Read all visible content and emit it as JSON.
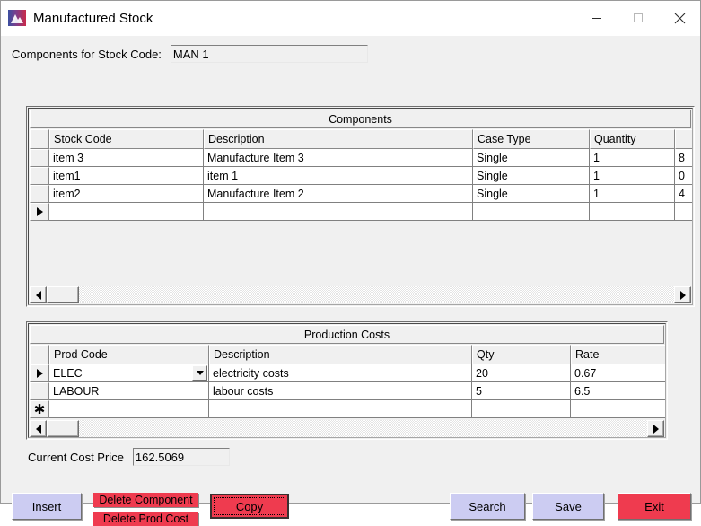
{
  "window": {
    "title": "Manufactured Stock",
    "icon": "mountain-logo-icon",
    "controls": {
      "minimize": "minimize-icon",
      "maximize": "maximize-icon",
      "close": "close-icon"
    }
  },
  "stock_code": {
    "label": "Components for Stock Code:",
    "value": "MAN 1",
    "placeholder": ""
  },
  "components_grid": {
    "caption": "Components",
    "columns": [
      "",
      "Stock Code",
      "Description",
      "Case Type",
      "Quantity",
      ""
    ],
    "rows": [
      {
        "marker": "",
        "stock_code": "item 3",
        "description": "Manufacture Item 3",
        "case_type": "Single",
        "quantity": "1",
        "extra": "8"
      },
      {
        "marker": "",
        "stock_code": "item1",
        "description": "item 1",
        "case_type": "Single",
        "quantity": "1",
        "extra": "0"
      },
      {
        "marker": "",
        "stock_code": "item2",
        "description": "Manufacture Item 2",
        "case_type": "Single",
        "quantity": "1",
        "extra": "4"
      },
      {
        "marker": "▶",
        "stock_code": "",
        "description": "",
        "case_type": "",
        "quantity": "",
        "extra": ""
      }
    ],
    "scroll": {
      "left_arrow": "scroll-left-icon",
      "right_arrow": "scroll-right-icon"
    }
  },
  "production_costs_grid": {
    "caption": "Production Costs",
    "columns": [
      "",
      "Prod Code",
      "Description",
      "Qty",
      "Rate"
    ],
    "rows": [
      {
        "marker": "▶",
        "prod_code": "ELEC",
        "has_dropdown": true,
        "description": "electricity costs",
        "qty": "20",
        "rate": "0.67"
      },
      {
        "marker": "",
        "prod_code": "LABOUR",
        "has_dropdown": false,
        "description": "labour costs",
        "qty": "5",
        "rate": "6.5"
      },
      {
        "marker": "✱",
        "prod_code": "",
        "has_dropdown": false,
        "description": "",
        "qty": "",
        "rate": ""
      }
    ],
    "scroll": {
      "left_arrow": "scroll-left-icon",
      "right_arrow": "scroll-right-icon"
    }
  },
  "cost_price": {
    "label": "Current Cost Price",
    "value": "162.5069"
  },
  "buttons": {
    "insert": "Insert",
    "delete_component": "Delete Component",
    "delete_prod_cost": "Delete Prod Cost",
    "copy": "Copy",
    "search": "Search",
    "save": "Save",
    "exit": "Exit"
  },
  "colors": {
    "button_lavender": "#ccccf2",
    "button_red": "#ef3b4f",
    "window_background": "#f0f0f0",
    "grid_cell_background": "#ffffff",
    "titlebar_background": "#ffffff"
  }
}
